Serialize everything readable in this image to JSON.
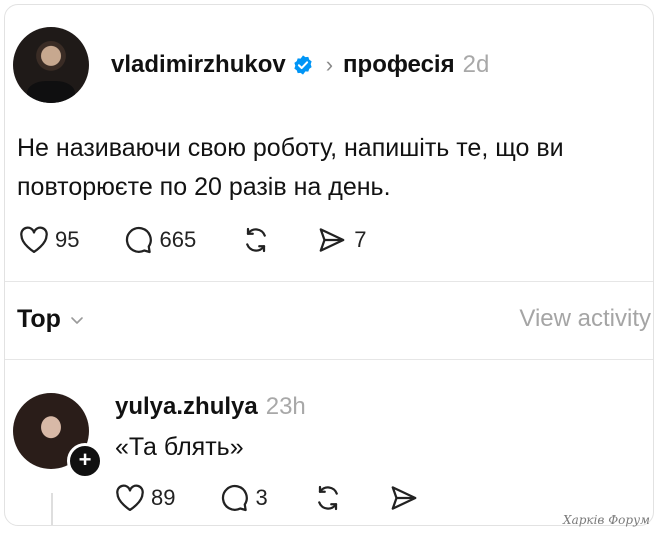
{
  "post": {
    "author": "vladimirzhukov",
    "topic": "професія",
    "time": "2d",
    "text": "Не називаючи свою роботу, напишіть те, що ви повторюєте по 20 разів на день.",
    "likes": "95",
    "comments": "665",
    "shares": "7"
  },
  "sort": {
    "label": "Top",
    "view_activity": "View activity"
  },
  "reply": {
    "author": "yulya.zhulya",
    "time": "23h",
    "text": "«Та блять»",
    "likes": "89",
    "comments": "3"
  },
  "watermark": "Харків Форум",
  "colors": {
    "verified_blue": "#0095f6",
    "muted_text": "#a8a8a8",
    "divider": "#e6e6e6"
  },
  "icons": [
    "heart-icon",
    "comment-icon",
    "repost-icon",
    "share-icon",
    "verified-badge-icon",
    "chevron-right-icon",
    "chevron-down-icon",
    "plus-icon"
  ]
}
